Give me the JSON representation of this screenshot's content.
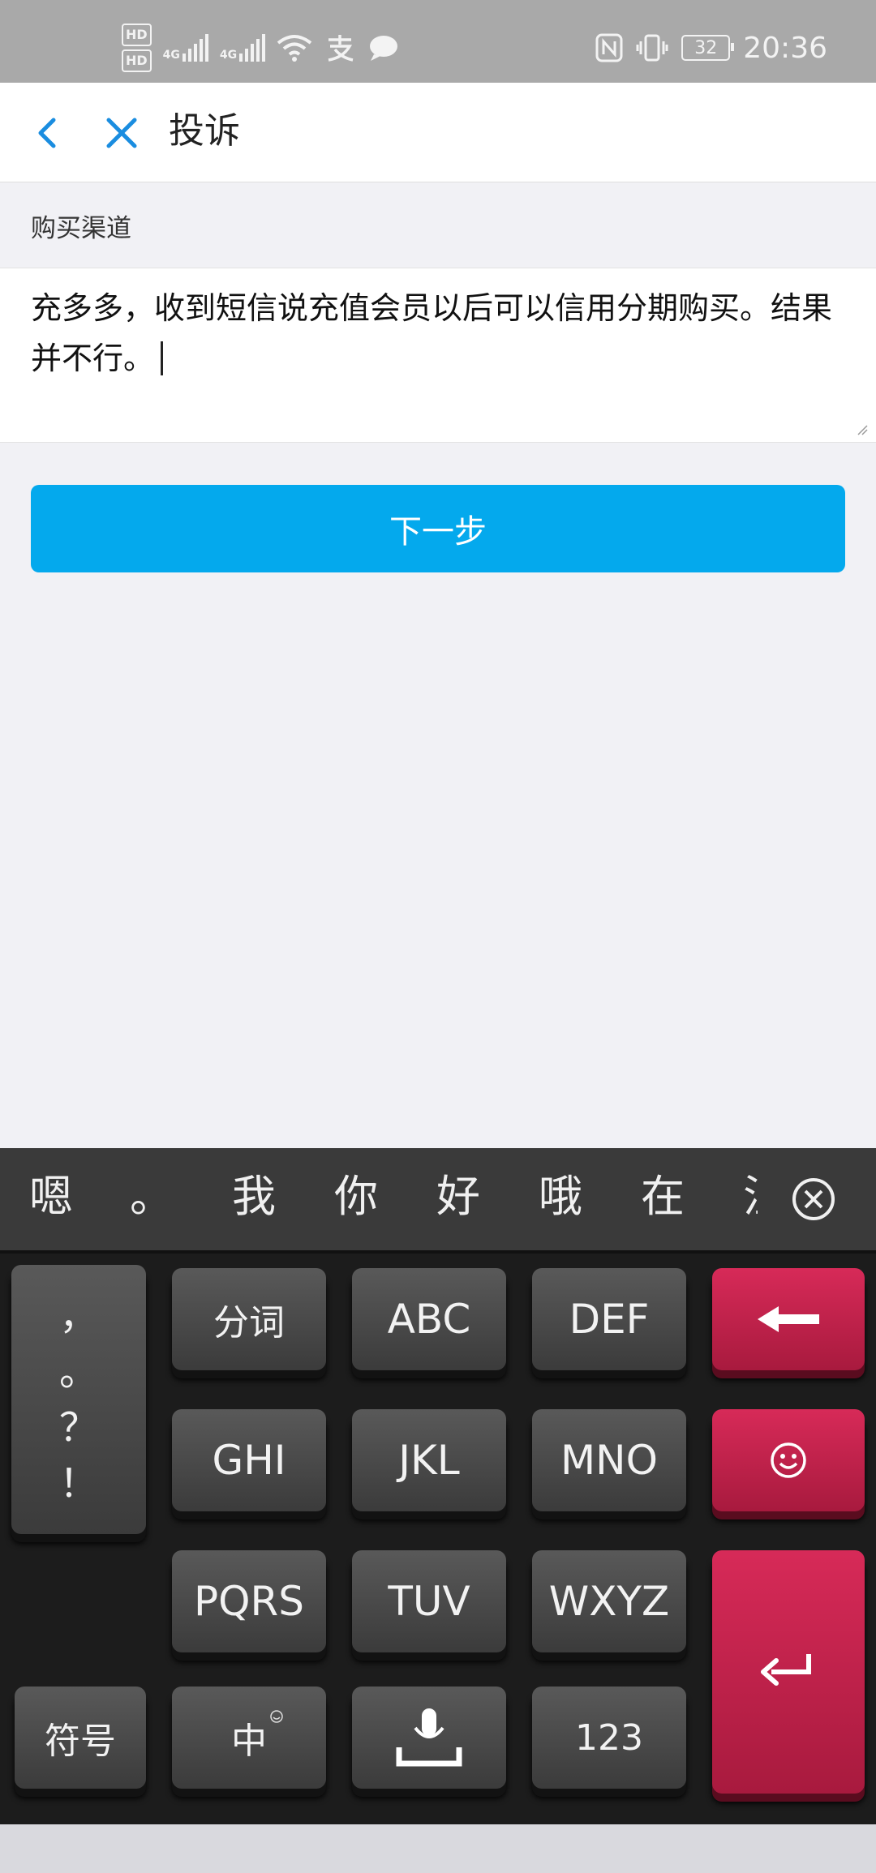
{
  "status_bar": {
    "hd1": "HD",
    "hd2": "HD",
    "net1": "4G",
    "net2": "4G",
    "battery": "32",
    "time": "20:36"
  },
  "header": {
    "title": "投诉"
  },
  "form": {
    "label": "购买渠道",
    "text": "充多多，收到短信说充值会员以后可以信用分期购买。结果并不行。"
  },
  "next_button": "下一步",
  "keyboard": {
    "candidates": [
      "嗯",
      "。",
      "我",
      "你",
      "好",
      "哦",
      "在",
      "注"
    ],
    "punct": [
      "，",
      "。",
      "？",
      "！"
    ],
    "keys": {
      "fenci": "分词",
      "abc": "ABC",
      "def": "DEF",
      "ghi": "GHI",
      "jkl": "JKL",
      "mno": "MNO",
      "pqrs": "PQRS",
      "tuv": "TUV",
      "wxyz": "WXYZ",
      "symbol": "符号",
      "zhong": "中",
      "num": "123"
    }
  },
  "colors": {
    "accent": "#04a9ed",
    "key_red": "#c4224d",
    "icon_blue": "#1a8de0"
  }
}
